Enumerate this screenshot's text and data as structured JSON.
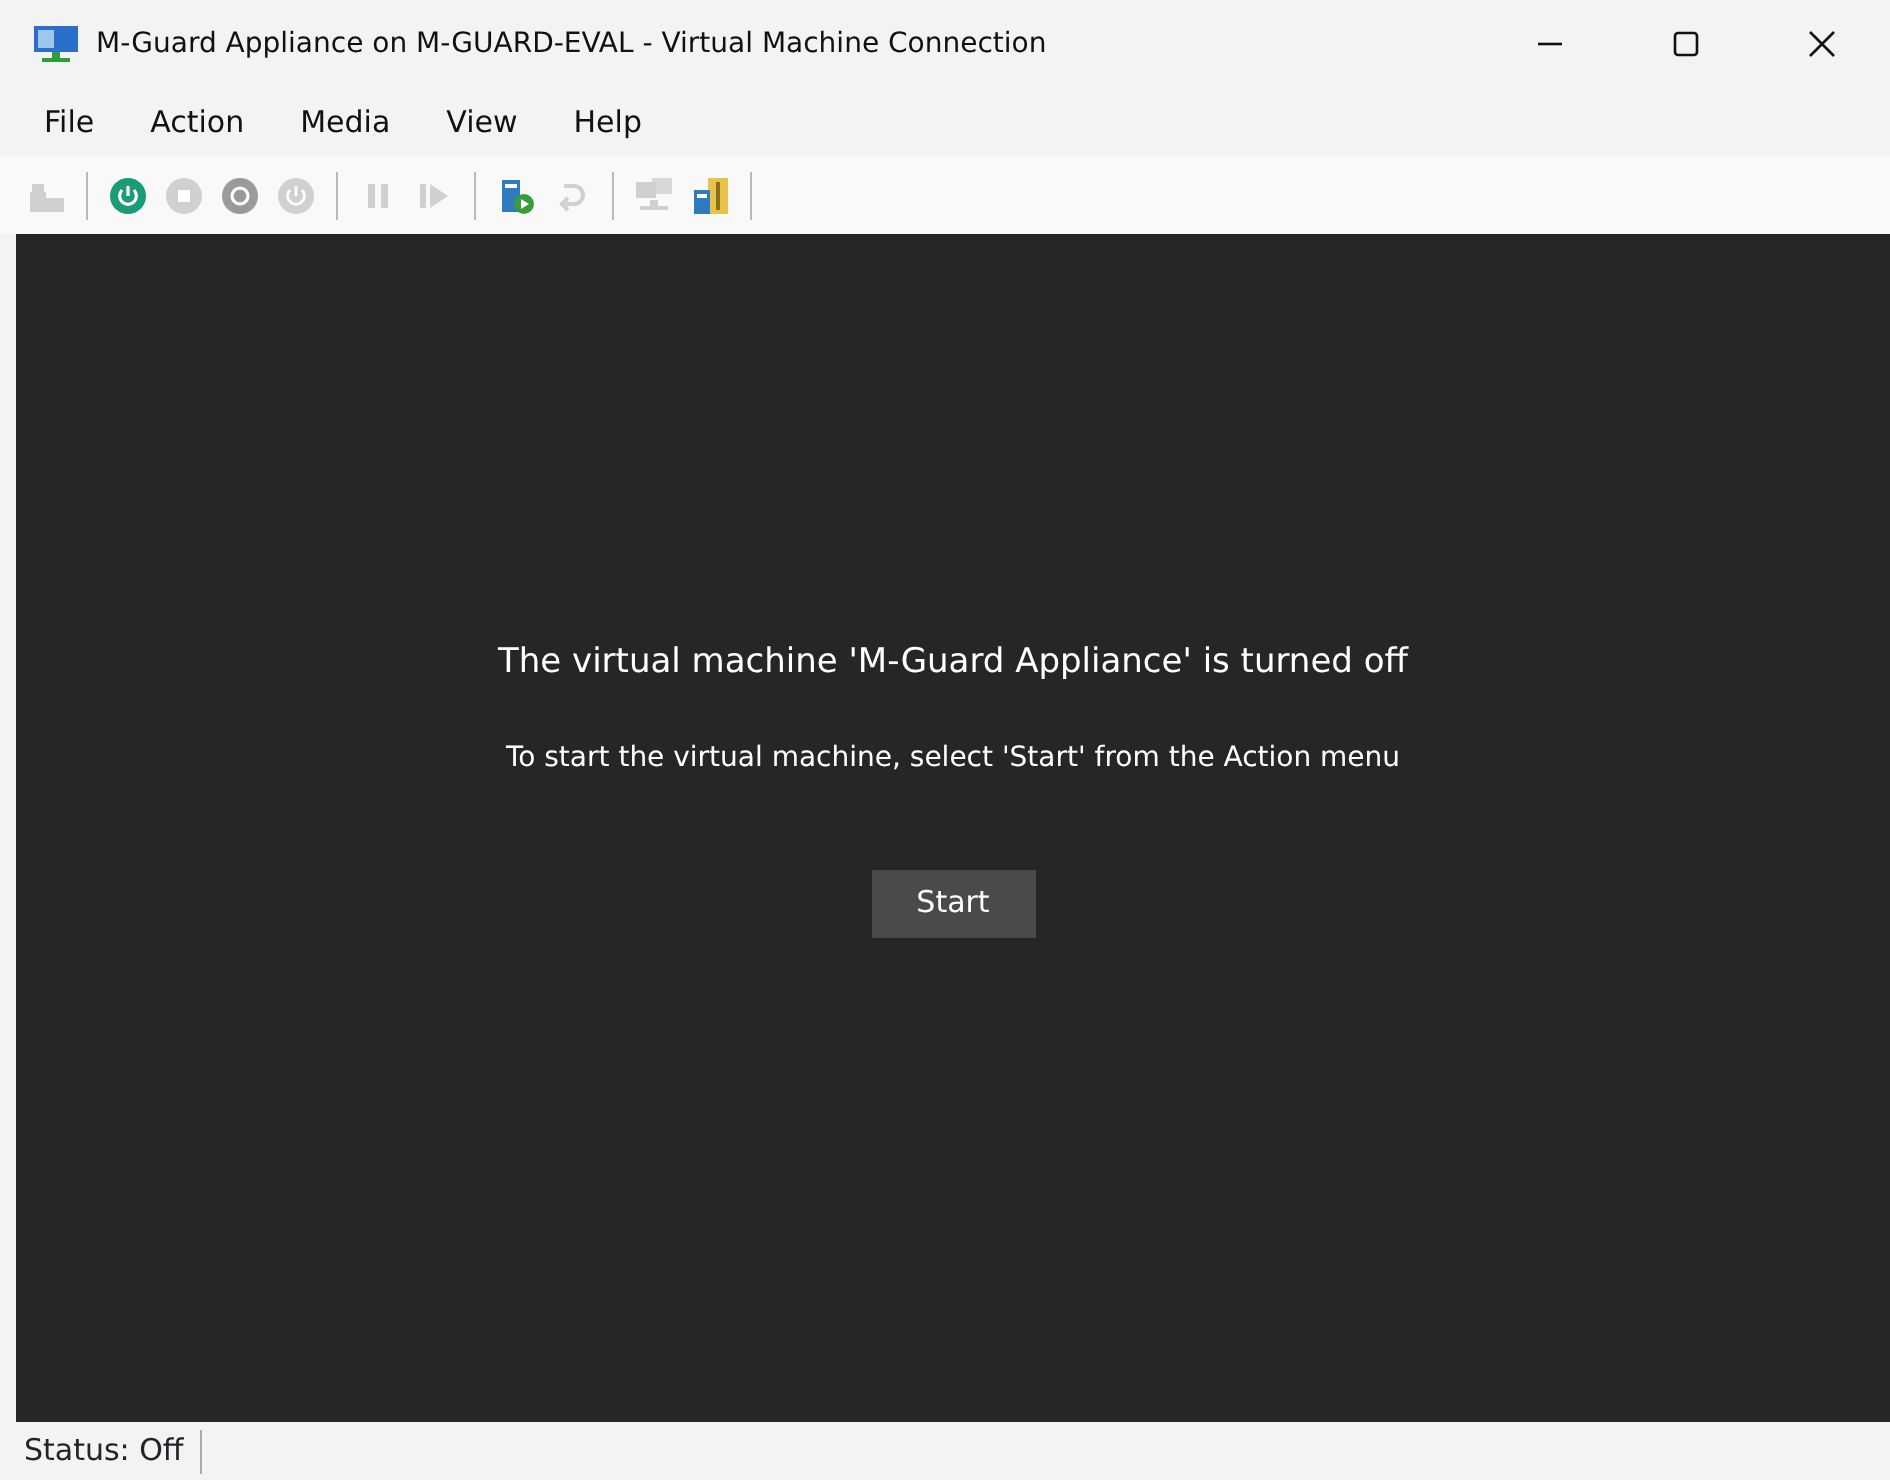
{
  "window": {
    "title": "M-Guard Appliance on M-GUARD-EVAL - Virtual Machine Connection"
  },
  "menu": [
    "File",
    "Action",
    "Media",
    "View",
    "Help"
  ],
  "toolbar": [
    {
      "kind": "ctrlaltdel",
      "disabled": true
    },
    {
      "kind": "separator"
    },
    {
      "kind": "start",
      "disabled": false
    },
    {
      "kind": "turnoff",
      "disabled": true
    },
    {
      "kind": "shutdown",
      "disabled": false
    },
    {
      "kind": "save",
      "disabled": true
    },
    {
      "kind": "separator"
    },
    {
      "kind": "pause",
      "disabled": true
    },
    {
      "kind": "resume",
      "disabled": true
    },
    {
      "kind": "separator"
    },
    {
      "kind": "checkpoint",
      "disabled": false
    },
    {
      "kind": "revert",
      "disabled": true
    },
    {
      "kind": "separator"
    },
    {
      "kind": "session",
      "disabled": true
    },
    {
      "kind": "share",
      "disabled": false
    },
    {
      "kind": "separator"
    }
  ],
  "screen": {
    "heading": "The virtual machine 'M-Guard Appliance' is turned off",
    "message": "To start the virtual machine, select 'Start' from the Action menu",
    "button": "Start"
  },
  "status_bar": {
    "status": "Status: Off"
  }
}
